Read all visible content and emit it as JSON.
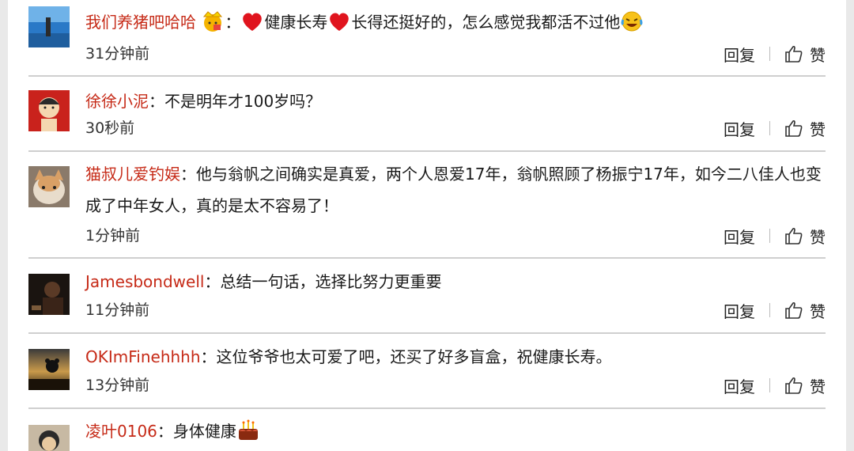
{
  "reply_label": "回复",
  "like_label": "赞",
  "comments": [
    {
      "name": "我们养猪吧哈哈",
      "text_parts": [
        "健康长寿",
        "长得还挺好的，怎么感觉我都活不过他"
      ],
      "time": "31分钟前",
      "icons": [
        "crown-emoji-icon",
        "heart-icon",
        "heart-icon",
        "laughing-emoji-icon"
      ]
    },
    {
      "name": "徐徐小泥",
      "text": "不是明年才100岁吗？",
      "time": "30秒前"
    },
    {
      "name": "猫叔儿爱钓娱",
      "text": "他与翁帆之间确实是真爱，两个人恩爱17年，翁帆照顾了杨振宁17年，如今二八佳人也变成了中年女人，真的是太不容易了！",
      "time": "1分钟前"
    },
    {
      "name": "Jamesbondwell",
      "text": "总结一句话，选择比努力更重要",
      "time": "11分钟前"
    },
    {
      "name": "OKImFinehhhh",
      "text": "这位爷爷也太可爱了吧，还买了好多盲盒，祝健康长寿。",
      "time": "13分钟前"
    },
    {
      "name": "凌叶0106",
      "text": "身体健康",
      "icons": [
        "cake-emoji-icon"
      ]
    }
  ],
  "colors": {
    "name": "#c62a17",
    "text": "#1a1a1a",
    "divider": "#cfcfcf",
    "heart": "#e0141e"
  }
}
